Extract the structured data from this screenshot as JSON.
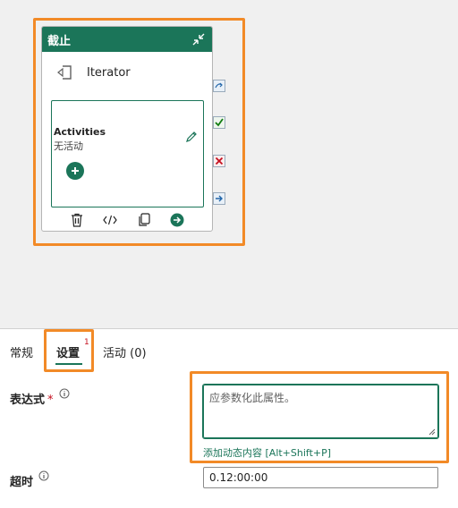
{
  "canvas": {
    "card": {
      "title": "截止",
      "iterator_label": "Iterator",
      "activities_title": "Activities",
      "activities_sub": "无活动"
    }
  },
  "tabs": [
    {
      "label": "常规"
    },
    {
      "label": "设置",
      "badge": "1"
    },
    {
      "label": "活动 (0)"
    }
  ],
  "settings": {
    "expression_label": "表达式",
    "required_mark": "*",
    "expression_placeholder": "应参数化此属性。",
    "dynamic_link": "添加动态内容 [Alt+Shift+P]",
    "timeout_label": "超时",
    "timeout_value": "0.12:00:00"
  },
  "colors": {
    "accent": "#1b7559",
    "highlight": "#f28a27",
    "required": "#c50f1f"
  },
  "icons": {
    "collapse": "collapse-icon",
    "iterator": "iterator-icon",
    "edit": "pencil-icon",
    "add": "add-icon",
    "delete": "trash-icon",
    "code": "code-icon",
    "copy": "copy-icon",
    "next": "arrow-right-icon",
    "skip": "skip-icon",
    "success": "check-icon",
    "failure": "x-icon",
    "completion": "completion-arrow-icon",
    "info": "info-icon"
  }
}
